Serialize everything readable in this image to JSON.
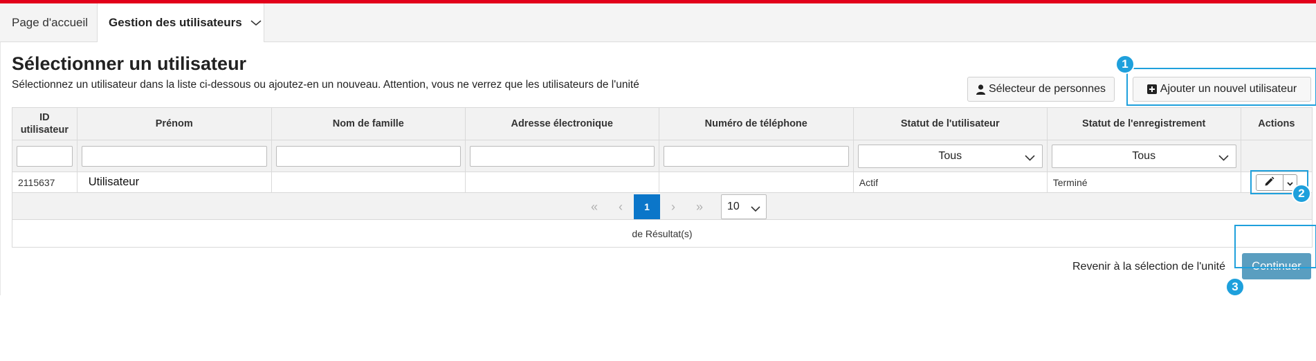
{
  "nav": {
    "home_label": "Page d'accueil",
    "users_label": "Gestion des utilisateurs"
  },
  "page": {
    "title": "Sélectionner un utilisateur",
    "subtitle": "Sélectionnez un utilisateur dans la liste ci-dessous ou ajoutez-en un nouveau. Attention, vous ne verrez que les utilisateurs de l'unité"
  },
  "toolbar": {
    "person_selector_label": "Sélecteur de personnes",
    "add_user_label": "Ajouter un nouvel utilisateur"
  },
  "table": {
    "headers": {
      "id": "ID utilisateur",
      "first_name": "Prénom",
      "last_name": "Nom de famille",
      "email": "Adresse électronique",
      "phone": "Numéro de téléphone",
      "user_status": "Statut de l'utilisateur",
      "registration_status": "Statut de l'enregistrement",
      "actions": "Actions"
    },
    "filters": {
      "user_status_value": "Tous",
      "registration_status_value": "Tous"
    },
    "rows": [
      {
        "id": "2115637",
        "first_name": "Utilisateur",
        "last_name": "",
        "email": "",
        "phone": "",
        "user_status": "Actif",
        "registration_status": "Terminé"
      }
    ],
    "pager": {
      "first": "«",
      "prev": "‹",
      "current_page": "1",
      "next": "›",
      "last": "»",
      "page_size": "10"
    },
    "result_text": "de Résultat(s)"
  },
  "footer": {
    "back_label": "Revenir à la sélection de l'unité",
    "continue_label": "Continuer"
  },
  "callouts": [
    "1",
    "2",
    "3"
  ],
  "colors": {
    "top_accent": "#e2001a",
    "callout": "#1ea0dc",
    "pager_active": "#0b76c9",
    "continue_button": "#5a9ec0"
  },
  "icons": {
    "nav_dropdown": "chevron-down-icon",
    "person_selector": "user-icon",
    "add_user": "plus-square-icon",
    "edit": "pencil-icon",
    "actions_dropdown": "caret-down-icon",
    "select": "chevron-down-icon"
  }
}
